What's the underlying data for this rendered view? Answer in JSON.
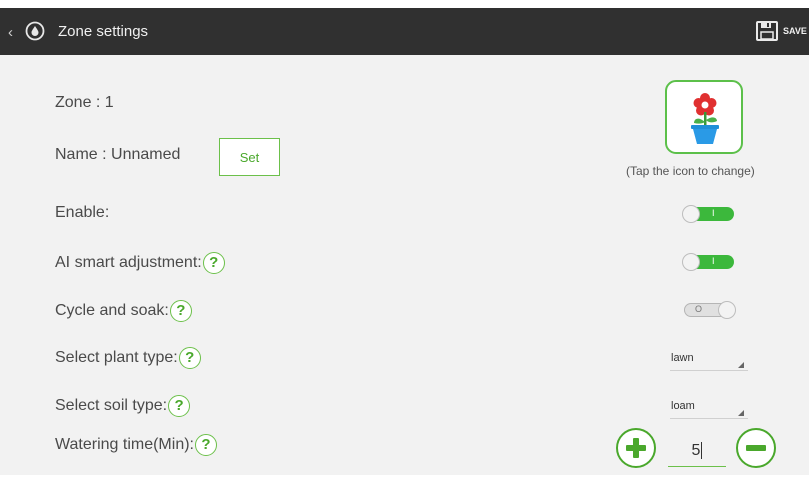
{
  "header": {
    "title": "Zone settings",
    "save_label": "SAVE"
  },
  "zone": {
    "label": "Zone : 1"
  },
  "name": {
    "label": "Name : Unnamed",
    "set_button": "Set"
  },
  "plant_icon": {
    "hint": "(Tap the icon to change)"
  },
  "settings": {
    "enable": {
      "label": "Enable:",
      "state": "on",
      "mark": "I"
    },
    "ai": {
      "label": "AI smart adjustment:",
      "help": "?",
      "state": "on",
      "mark": "I"
    },
    "cycle": {
      "label": "Cycle and soak:",
      "help": "?",
      "state": "off",
      "mark": "O"
    },
    "plant_type": {
      "label": "Select plant type:",
      "help": "?",
      "value": "lawn"
    },
    "soil_type": {
      "label": "Select soil type:",
      "help": "?",
      "value": "loam"
    },
    "watering": {
      "label": "Watering time(Min):",
      "help": "?",
      "value": "5"
    }
  },
  "colors": {
    "accent": "#4aa82c",
    "toggle_on": "#3cb83c",
    "topbar": "#303030",
    "background": "#f2f2f2"
  }
}
